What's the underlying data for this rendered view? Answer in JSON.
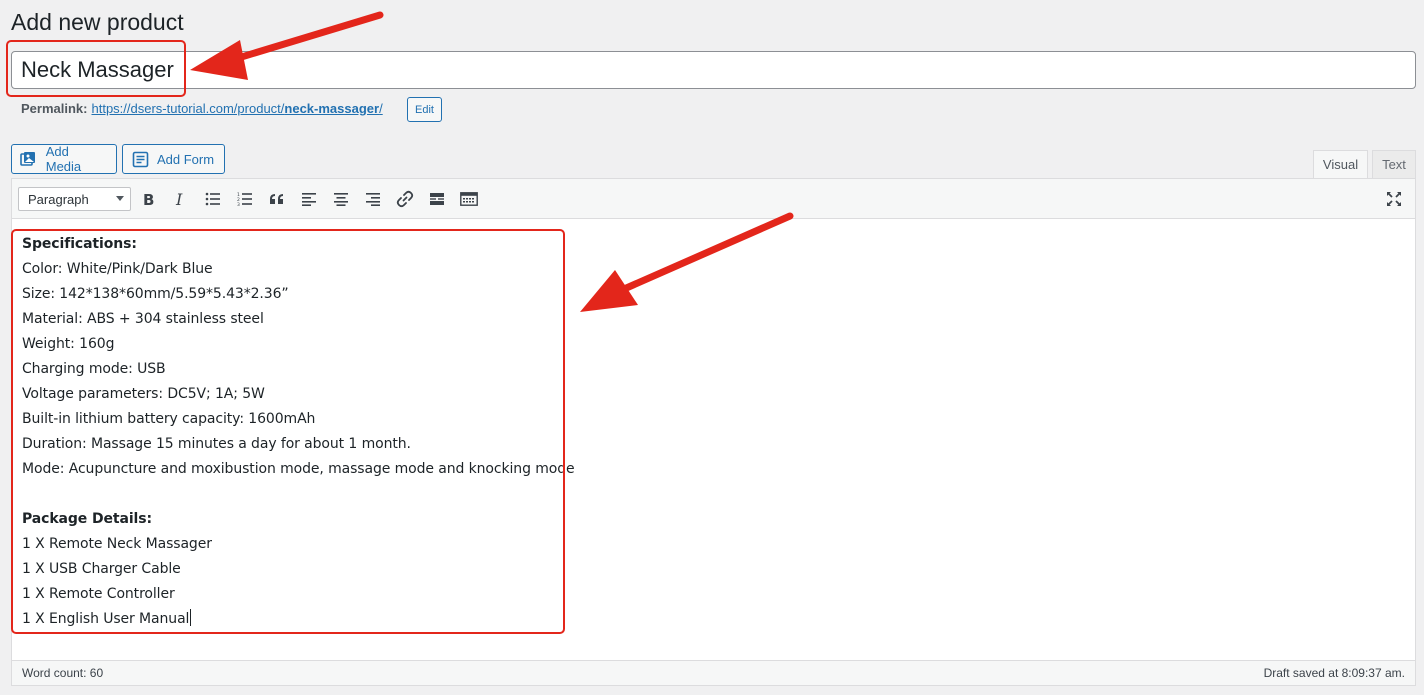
{
  "page": {
    "title": "Add new product"
  },
  "product": {
    "title_value": "Neck Massager"
  },
  "permalink": {
    "label": "Permalink:",
    "url_prefix": "https://dsers-tutorial.com/product/",
    "url_slug": "neck-massager",
    "url_suffix": "/",
    "edit_label": "Edit"
  },
  "media_buttons": {
    "add_media": "Add Media",
    "add_form": "Add Form"
  },
  "editor_tabs": {
    "visual": "Visual",
    "text": "Text"
  },
  "toolbar": {
    "format_select": "Paragraph",
    "icons": [
      "bold-icon",
      "italic-icon",
      "bulleted-list-icon",
      "numbered-list-icon",
      "blockquote-icon",
      "align-left-icon",
      "align-center-icon",
      "align-right-icon",
      "link-icon",
      "read-more-icon",
      "toolbar-toggle-icon",
      "fullscreen-icon"
    ]
  },
  "content": {
    "spec_heading": "Specifications:",
    "spec_lines": [
      "Color: White/Pink/Dark Blue",
      "Size: 142*138*60mm/5.59*5.43*2.36”",
      "Material: ABS + 304 stainless steel",
      "Weight: 160g",
      "Charging mode: USB",
      "Voltage parameters: DC5V; 1A; 5W",
      "Built-in lithium battery capacity: 1600mAh",
      "Duration: Massage 15 minutes a day for about 1 month.",
      "Mode: Acupuncture and moxibustion mode, massage mode and knocking mode"
    ],
    "package_heading": "Package Details:",
    "package_lines": [
      "1 X Remote Neck Massager",
      "1 X USB Charger Cable",
      "1 X Remote Controller",
      "1 X English User Manual"
    ]
  },
  "status": {
    "word_count": "Word count: 60",
    "draft_saved": "Draft saved at 8:09:37 am."
  },
  "colors": {
    "accent": "#2271b1",
    "annotation": "#e3261b"
  }
}
